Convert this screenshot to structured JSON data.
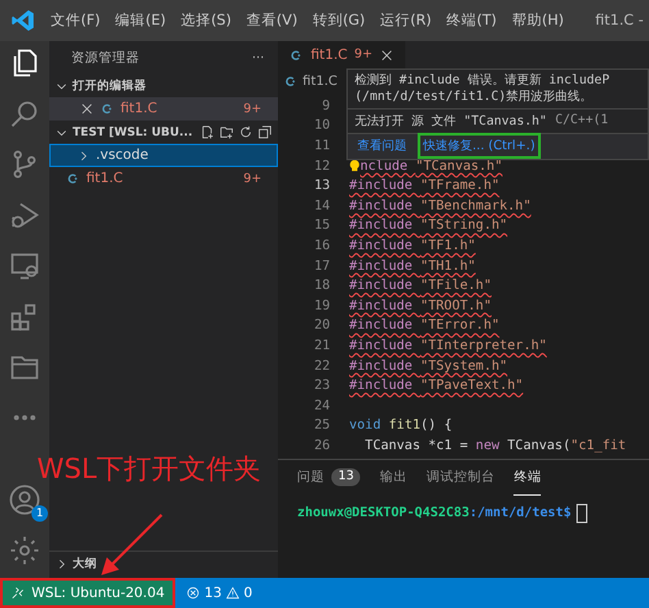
{
  "menu_bar": {
    "items": [
      "文件(F)",
      "编辑(E)",
      "选择(S)",
      "查看(V)",
      "转到(G)",
      "运行(R)",
      "终端(T)",
      "帮助(H)"
    ],
    "title": "fit1.C -"
  },
  "activity_bar": {
    "items": [
      {
        "kind": "explorer",
        "selected": true
      },
      {
        "kind": "search",
        "selected": false
      },
      {
        "kind": "source-control",
        "selected": false
      },
      {
        "kind": "run-debug",
        "selected": false
      },
      {
        "kind": "remote",
        "selected": false
      },
      {
        "kind": "extensions",
        "selected": false
      },
      {
        "kind": "folder",
        "selected": false
      },
      {
        "kind": "more",
        "selected": false
      }
    ],
    "account_badge": "1"
  },
  "sidebar": {
    "title": "资源管理器",
    "more": "···",
    "open_editors": {
      "title": "打开的编辑器",
      "expanded": true,
      "items": [
        {
          "name": "fit1.C",
          "badge": "9+",
          "selected": false
        }
      ]
    },
    "folder": {
      "title": "TEST [WSL: UBU...",
      "expanded": true,
      "items": [
        {
          "kind": "folder",
          "name": ".vscode",
          "selected": true
        },
        {
          "kind": "file",
          "name": "fit1.C",
          "badge": "9+",
          "selected": false
        }
      ]
    },
    "outline": {
      "title": "大纲",
      "expanded": false
    }
  },
  "editor": {
    "tabs": [
      {
        "name": "fit1.C",
        "badge": "9+",
        "selected": true
      }
    ],
    "breadcrumb": "fit1.C",
    "lines": [
      {
        "number": "9",
        "current": false
      },
      {
        "number": "10",
        "current": false
      },
      {
        "number": "11",
        "current": false
      },
      {
        "number": "12",
        "current": false,
        "error": true,
        "lightbulb": true,
        "tokens": [
          {
            "text": "nclude ",
            "kind": "directive"
          },
          {
            "text": "\"TCanvas.h\"",
            "kind": "string"
          }
        ]
      },
      {
        "number": "13",
        "current": true,
        "error": true,
        "lightbulb": false,
        "tokens": [
          {
            "text": "#include ",
            "kind": "directive"
          },
          {
            "text": "\"TFrame.h\"",
            "kind": "string"
          }
        ]
      },
      {
        "number": "14",
        "current": false,
        "error": true,
        "lightbulb": false,
        "tokens": [
          {
            "text": "#include ",
            "kind": "directive"
          },
          {
            "text": "\"TBenchmark.h\"",
            "kind": "string"
          }
        ]
      },
      {
        "number": "15",
        "current": false,
        "error": true,
        "lightbulb": false,
        "tokens": [
          {
            "text": "#include ",
            "kind": "directive"
          },
          {
            "text": "\"TString.h\"",
            "kind": "string"
          }
        ]
      },
      {
        "number": "16",
        "current": false,
        "error": true,
        "lightbulb": false,
        "tokens": [
          {
            "text": "#include ",
            "kind": "directive"
          },
          {
            "text": "\"TF1.h\"",
            "kind": "string"
          }
        ]
      },
      {
        "number": "17",
        "current": false,
        "error": true,
        "lightbulb": false,
        "tokens": [
          {
            "text": "#include ",
            "kind": "directive"
          },
          {
            "text": "\"TH1.h\"",
            "kind": "string"
          }
        ]
      },
      {
        "number": "18",
        "current": false,
        "error": true,
        "lightbulb": false,
        "tokens": [
          {
            "text": "#include ",
            "kind": "directive"
          },
          {
            "text": "\"TFile.h\"",
            "kind": "string"
          }
        ]
      },
      {
        "number": "19",
        "current": false,
        "error": true,
        "lightbulb": false,
        "tokens": [
          {
            "text": "#include ",
            "kind": "directive"
          },
          {
            "text": "\"TROOT.h\"",
            "kind": "string"
          }
        ]
      },
      {
        "number": "20",
        "current": false,
        "error": true,
        "lightbulb": false,
        "tokens": [
          {
            "text": "#include ",
            "kind": "directive"
          },
          {
            "text": "\"TError.h\"",
            "kind": "string"
          }
        ]
      },
      {
        "number": "21",
        "current": false,
        "error": true,
        "lightbulb": false,
        "tokens": [
          {
            "text": "#include ",
            "kind": "directive"
          },
          {
            "text": "\"TInterpreter.h\"",
            "kind": "string"
          }
        ]
      },
      {
        "number": "22",
        "current": false,
        "error": true,
        "lightbulb": false,
        "tokens": [
          {
            "text": "#include ",
            "kind": "directive"
          },
          {
            "text": "\"TSystem.h\"",
            "kind": "string"
          }
        ]
      },
      {
        "number": "23",
        "current": false,
        "error": true,
        "lightbulb": false,
        "tokens": [
          {
            "text": "#include ",
            "kind": "directive"
          },
          {
            "text": "\"TPaveText.h\"",
            "kind": "string"
          }
        ]
      },
      {
        "number": "24",
        "current": false
      },
      {
        "number": "25",
        "current": false,
        "error": false,
        "lightbulb": false,
        "tokens": [
          {
            "text": "void ",
            "kind": "keyword"
          },
          {
            "text": "fit1",
            "kind": "function"
          },
          {
            "text": "() {",
            "kind": "plain"
          }
        ]
      },
      {
        "number": "26",
        "current": false,
        "error": false,
        "lightbulb": false,
        "tokens": [
          {
            "text": "  TCanvas *c1 = ",
            "kind": "plain"
          },
          {
            "text": "new ",
            "kind": "control"
          },
          {
            "text": "TCanvas(",
            "kind": "plain"
          },
          {
            "text": "\"c1_fit",
            "kind": "string"
          }
        ]
      }
    ],
    "hover": {
      "message": [
        "检测到 #include 错误。请更新 includeP",
        "(/mnt/d/test/fit1.C)禁用波形曲线。"
      ],
      "problem": "无法打开 源 文件 \"TCanvas.h\"",
      "source": "C/C++(1",
      "actions": [
        {
          "label": "查看问题",
          "outlined": false
        },
        {
          "label": "快速修复... (Ctrl+.)",
          "outlined": true
        }
      ]
    }
  },
  "panel": {
    "tabs": [
      {
        "label": "问题",
        "badge": "13",
        "selected": false
      },
      {
        "label": "输出",
        "selected": false
      },
      {
        "label": "调试控制台",
        "selected": false
      },
      {
        "label": "终端",
        "selected": true
      }
    ],
    "terminal": {
      "user_host": "zhouwx@DESKTOP-Q4S2C83",
      "path": ":/mnt/d/test$"
    }
  },
  "status_bar": {
    "remote": {
      "label": "WSL: Ubuntu-20.04",
      "outlined": true
    },
    "errors": "13",
    "warnings": "0"
  },
  "annotation": {
    "text": "WSL下打开文件夹"
  }
}
